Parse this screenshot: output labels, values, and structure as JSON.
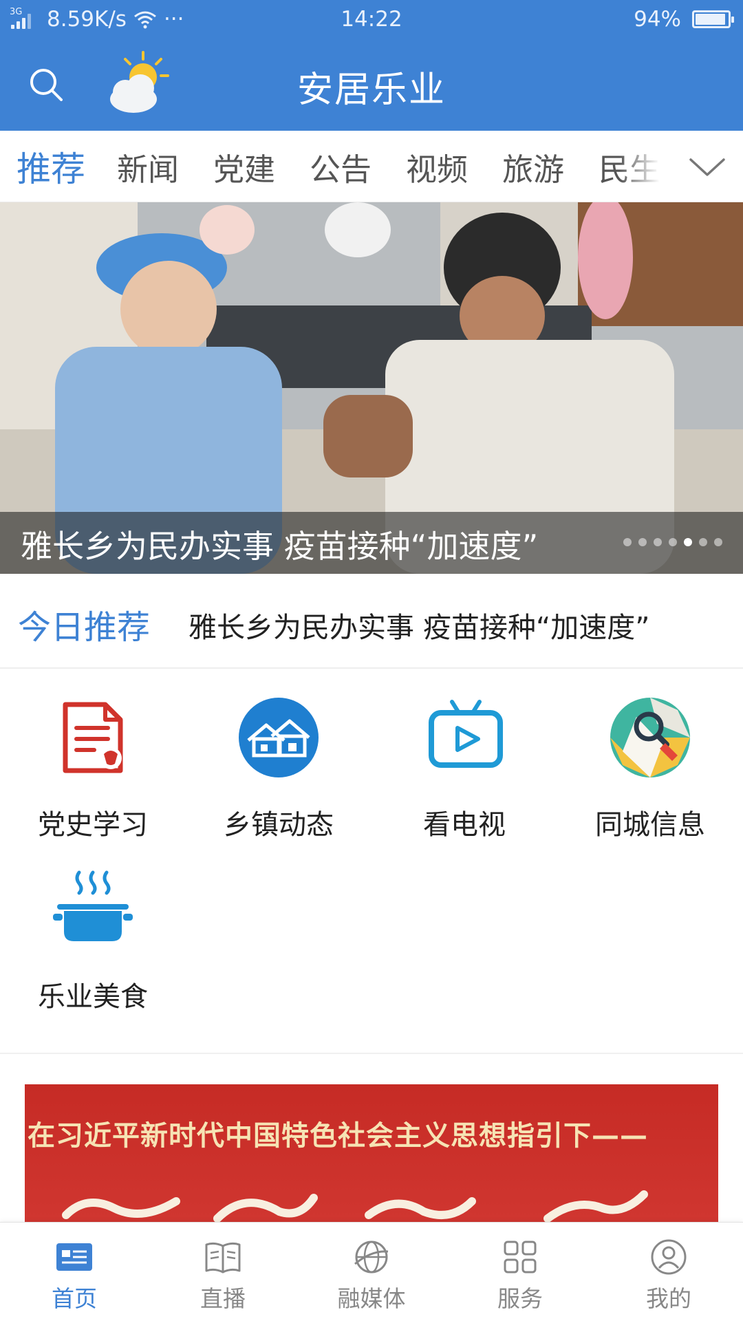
{
  "status_bar": {
    "network_type": "3G",
    "speed": "8.59K/s",
    "more": "···",
    "time": "14:22",
    "battery": "94%",
    "battery_level": 0.94
  },
  "header": {
    "title": "安居乐业"
  },
  "tabs": {
    "items": [
      "推荐",
      "新闻",
      "党建",
      "公告",
      "视频",
      "旅游",
      "民生"
    ],
    "active_index": 0
  },
  "banner": {
    "title": "雅长乡为民办实事 疫苗接种“加速度”",
    "slide_count": 7,
    "active_slide": 4
  },
  "today": {
    "label": "今日推荐",
    "headline": "雅长乡为民办实事 疫苗接种“加速度”"
  },
  "quick_access": [
    {
      "label": "党史学习",
      "icon": "party-history-document-icon"
    },
    {
      "label": "乡镇动态",
      "icon": "township-houses-icon"
    },
    {
      "label": "看电视",
      "icon": "tv-play-icon"
    },
    {
      "label": "同城信息",
      "icon": "city-map-search-icon"
    },
    {
      "label": "乐业美食",
      "icon": "cooking-pot-icon"
    }
  ],
  "promo": {
    "text": "在习近平新时代中国特色社会主义思想指引下——"
  },
  "bottom_nav": {
    "items": [
      {
        "label": "首页",
        "icon": "home-news-icon"
      },
      {
        "label": "直播",
        "icon": "book-icon"
      },
      {
        "label": "融媒体",
        "icon": "globe-icon"
      },
      {
        "label": "服务",
        "icon": "grid-icon"
      },
      {
        "label": "我的",
        "icon": "user-icon"
      }
    ],
    "active_index": 0
  },
  "colors": {
    "primary": "#3e82d4",
    "header_bg": "#3e82d4",
    "party_red": "#d0332b",
    "promo_red": "#c62b25",
    "promo_text": "#f6e3b4"
  }
}
